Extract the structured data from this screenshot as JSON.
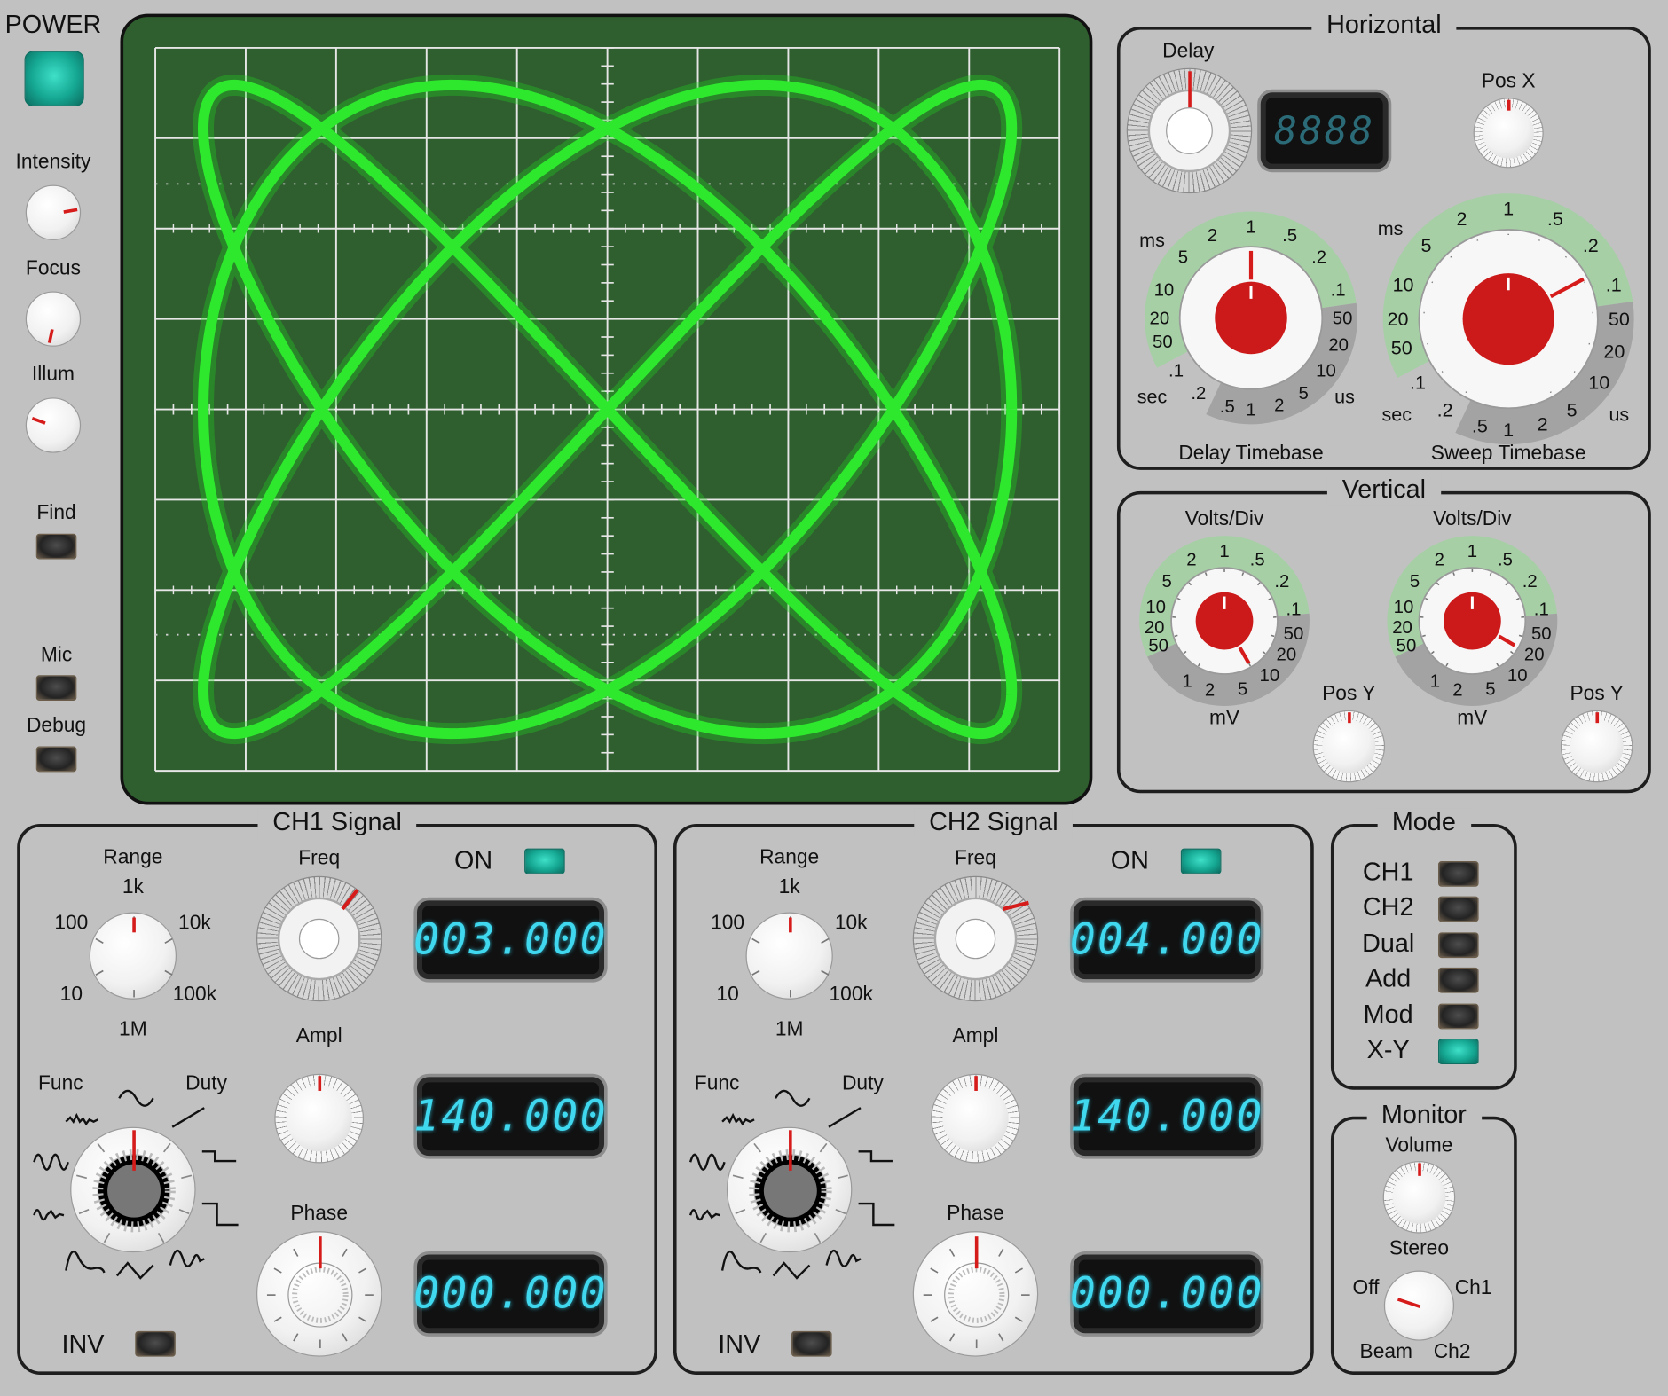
{
  "left": {
    "power_label": "POWER",
    "intensity_label": "Intensity",
    "focus_label": "Focus",
    "illum_label": "Illum",
    "find_label": "Find",
    "mic_label": "Mic",
    "debug_label": "Debug"
  },
  "horizontal": {
    "title": "Horizontal",
    "delay_label": "Delay",
    "delay_readout": "8888",
    "posx_label": "Pos X",
    "delay_timebase_label": "Delay Timebase",
    "sweep_timebase_label": "Sweep Timebase",
    "ms_label": "ms",
    "sec_label": "sec",
    "us_label": "us",
    "scale_ms": [
      "50",
      "20",
      "10",
      "5",
      "2",
      "1",
      ".5",
      ".2",
      ".1"
    ],
    "scale_us": [
      "50",
      "20",
      "10",
      "5",
      "2",
      "1"
    ],
    "scale_sec": [
      ".1",
      ".2",
      ".5"
    ]
  },
  "vertical": {
    "title": "Vertical",
    "volts_div_label": "Volts/Div",
    "mv_label": "mV",
    "posy_label": "Pos Y",
    "scale_v": [
      "50",
      "20",
      "10",
      "5",
      "2",
      "1",
      ".5",
      ".2",
      ".1"
    ],
    "scale_mv": [
      "50",
      "20",
      "10",
      "5",
      "2",
      "1"
    ]
  },
  "ch1": {
    "title": "CH1 Signal",
    "on_label": "ON",
    "range_label": "Range",
    "range_options": [
      "1k",
      "10k",
      "100k",
      "1M",
      "10",
      "100"
    ],
    "freq_label": "Freq",
    "freq_value": "003.000",
    "ampl_label": "Ampl",
    "ampl_value": "140.000",
    "phase_label": "Phase",
    "phase_value": "000.000",
    "func_label": "Func",
    "duty_label": "Duty",
    "inv_label": "INV"
  },
  "ch2": {
    "title": "CH2 Signal",
    "on_label": "ON",
    "range_label": "Range",
    "range_options": [
      "1k",
      "10k",
      "100k",
      "1M",
      "10",
      "100"
    ],
    "freq_label": "Freq",
    "freq_value": "004.000",
    "ampl_label": "Ampl",
    "ampl_value": "140.000",
    "phase_label": "Phase",
    "phase_value": "000.000",
    "func_label": "Func",
    "duty_label": "Duty",
    "inv_label": "INV"
  },
  "mode": {
    "title": "Mode",
    "items": [
      "CH1",
      "CH2",
      "Dual",
      "Add",
      "Mod",
      "X-Y"
    ],
    "active": "X-Y"
  },
  "monitor": {
    "title": "Monitor",
    "volume_label": "Volume",
    "stereo_label": "Stereo",
    "off_label": "Off",
    "ch1_label": "Ch1",
    "beam_label": "Beam",
    "ch2_label": "Ch2"
  },
  "colors": {
    "panel_bg": "#c1c1c1",
    "screen_bg": "#2f5e2f",
    "trace": "#22e022",
    "lcd_text": "#40d8ef",
    "knob_red": "#cc1a1a",
    "scale_green": "#a6cfa6",
    "scale_gray": "#9f9f9f"
  }
}
